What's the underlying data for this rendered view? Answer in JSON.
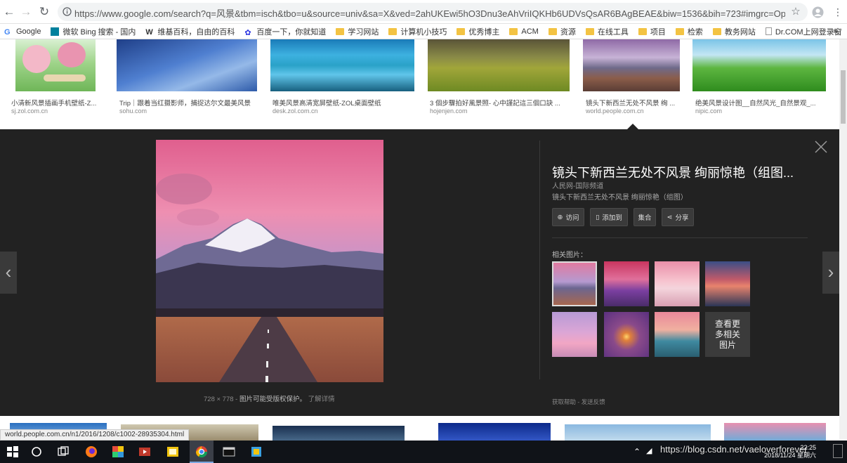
{
  "browser": {
    "url": "https://www.google.com/search?q=风景&tbm=isch&tbo=u&source=univ&sa=X&ved=2ahUKEwi5hO3Dnu3eAhVriIQKHb6UDVsQsAR6BAgBEAE&biw=1536&bih=723#imgrc=OpiOPyoVst0...",
    "bookmarks": [
      {
        "label": "Google",
        "icon": "google-icon"
      },
      {
        "label": "微软 Bing 搜索 - 国内",
        "icon": "bing-icon"
      },
      {
        "label": "维基百科，自由的百科",
        "icon": "wikipedia-icon"
      },
      {
        "label": "百度一下，你就知道",
        "icon": "baidu-icon"
      },
      {
        "label": "学习网站",
        "icon": "folder-icon"
      },
      {
        "label": "计算机小技巧",
        "icon": "folder-icon"
      },
      {
        "label": "优秀博主",
        "icon": "folder-icon"
      },
      {
        "label": "ACM",
        "icon": "folder-icon"
      },
      {
        "label": "资源",
        "icon": "folder-icon"
      },
      {
        "label": "在线工具",
        "icon": "folder-icon"
      },
      {
        "label": "项目",
        "icon": "folder-icon"
      },
      {
        "label": "检索",
        "icon": "folder-icon"
      },
      {
        "label": "教务网站",
        "icon": "folder-icon"
      },
      {
        "label": "Dr.COM上网登录窗",
        "icon": "page-icon"
      }
    ],
    "more_bookmarks": "»"
  },
  "results_strip": [
    {
      "title": "小清新风景插画手机壁纸-Z...",
      "domain": "sj.zol.com.cn"
    },
    {
      "title": "Trip｜跟着当红摄影师，捕捉达尔文最美风景",
      "domain": "sohu.com"
    },
    {
      "title": "唯美风景高清宽屏壁纸-ZOL桌面壁纸",
      "domain": "desk.zol.com.cn"
    },
    {
      "title": "3 個步驟拍好風景照- 心中謹記這三個口訣 ...",
      "domain": "hojenjen.com"
    },
    {
      "title": "镜头下新西兰无处不风景 绚 ...",
      "domain": "world.people.com.cn"
    },
    {
      "title": "绝美风景设计图__自然风光_自然景观_...",
      "domain": "nipic.com"
    }
  ],
  "panel": {
    "title": "镜头下新西兰无处不风景 绚丽惊艳（组图...",
    "source": "人民网-国际频道",
    "description": "镜头下新西兰无处不风景 绚丽惊艳（组图）",
    "actions": [
      {
        "label": "访问",
        "icon": "globe-icon"
      },
      {
        "label": "添加到",
        "icon": "bookmark-icon"
      },
      {
        "label": "集合",
        "icon": ""
      },
      {
        "label": "分享",
        "icon": "share-icon"
      }
    ],
    "related_label": "相关图片：",
    "more_related": "查看更多相关图片",
    "image_size": "728 × 778",
    "caption_separator": "-",
    "copyright": "图片可能受版权保护。",
    "learn_more": "了解详情",
    "feedback_help": "获取帮助",
    "feedback_sep": "-",
    "feedback_send": "发送反馈"
  },
  "status_url": "world.people.com.cn/n1/2016/1208/c1002-28935304.html",
  "taskbar": {
    "watermark": "https://blog.csdn.net/vaeloverforever",
    "time": "22:25",
    "date": "2018/11/24 星期六"
  }
}
